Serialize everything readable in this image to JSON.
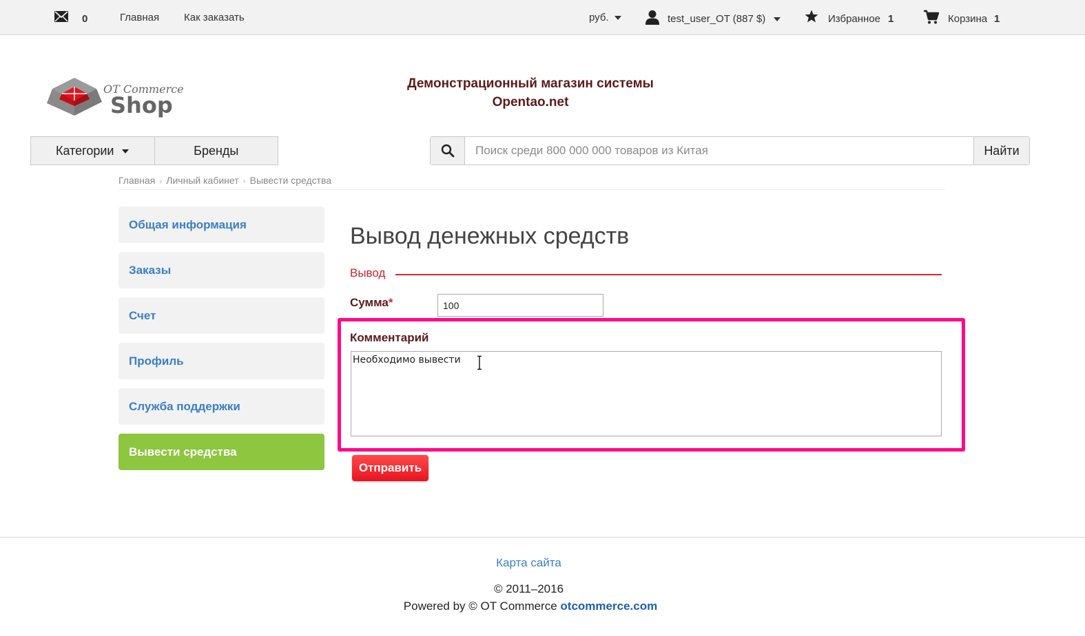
{
  "topbar": {
    "mail_count": "0",
    "nav_main": "Главная",
    "nav_how": "Как заказать",
    "currency": "руб.",
    "user": "test_user_OT (887 $)",
    "favorites_label": "Избранное",
    "favorites_count": "1",
    "cart_label": "Корзина",
    "cart_count": "1"
  },
  "header": {
    "logo_line1": "OT Commerce",
    "logo_line2": "Shop",
    "title_line1": "Демонстрационный магазин системы",
    "title_line2": "Opentao.net"
  },
  "menu": {
    "categories": "Категории",
    "brands": "Бренды"
  },
  "search": {
    "placeholder": "Поиск среди 800 000 000 товаров из Китая",
    "button": "Найти"
  },
  "breadcrumb": [
    "Главная",
    "Личный кабинет",
    "Вывести средства"
  ],
  "sidebar": {
    "items": [
      {
        "label": "Общая информация"
      },
      {
        "label": "Заказы"
      },
      {
        "label": "Счет"
      },
      {
        "label": "Профиль"
      },
      {
        "label": "Служба поддержки"
      },
      {
        "label": "Вывести средства"
      }
    ]
  },
  "form": {
    "title": "Вывод денежных средств",
    "legend": "Вывод",
    "sum_label": "Сумма",
    "required_mark": "*",
    "sum_value": "100",
    "comment_label": "Комментарий",
    "comment_value": "Необходимо вывести",
    "submit": "Отправить"
  },
  "footer": {
    "sitemap": "Карта сайта",
    "copyright": "© 2011–2016",
    "powered_prefix": "Powered by © OT Commerce",
    "powered_link": "otcommerce.com"
  },
  "colors": {
    "accent_green": "#8dc63f",
    "link_blue": "#3b7fc4",
    "red": "#e1222b",
    "highlight_pink": "#ff0a88"
  }
}
